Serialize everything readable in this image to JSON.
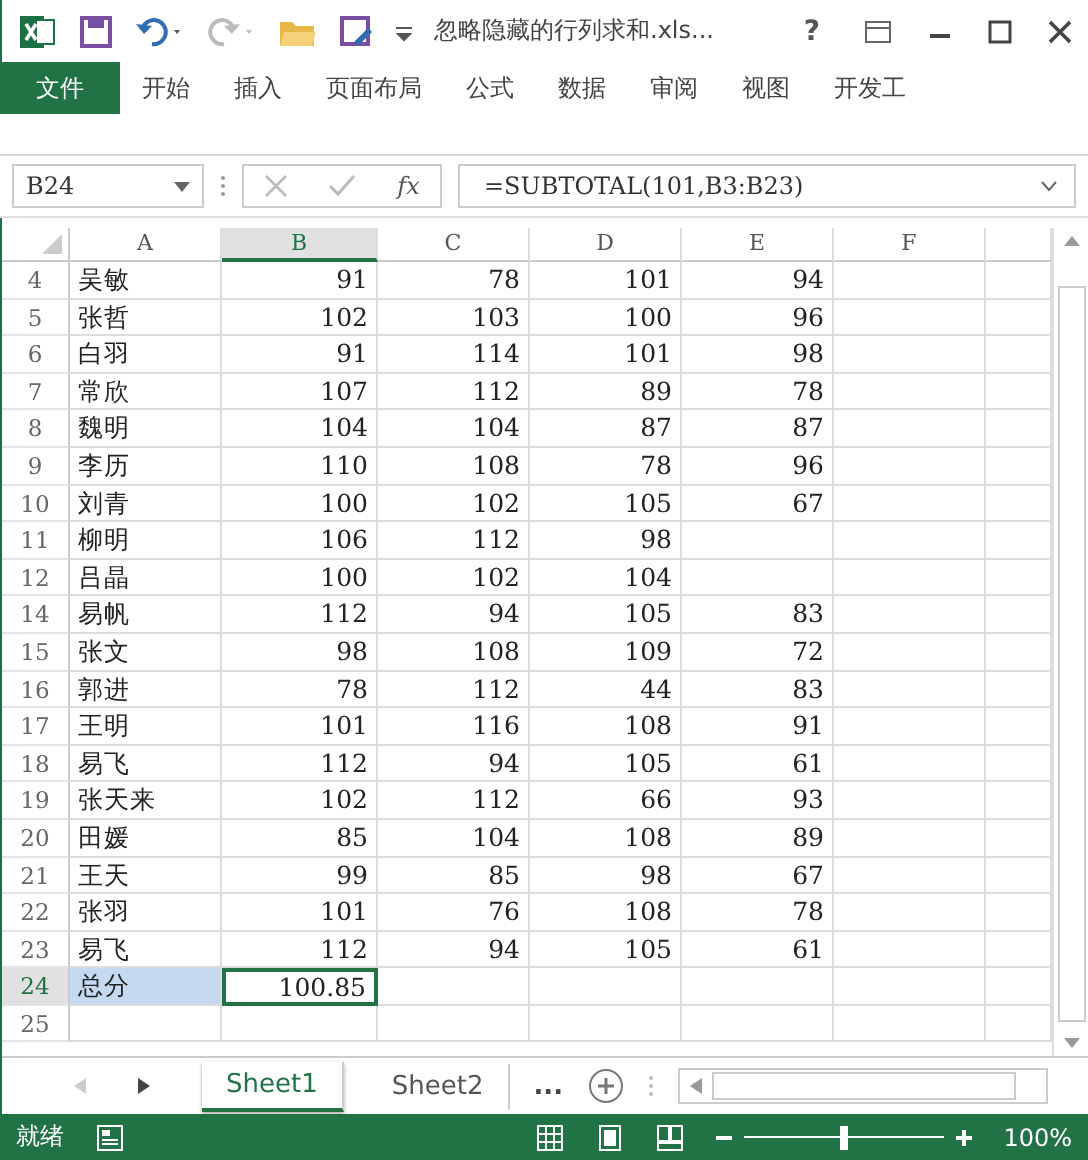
{
  "window": {
    "title": "忽略隐藏的行列求和.xls...",
    "help": "?"
  },
  "ribbon_tabs": [
    {
      "label": "文件",
      "selected": true
    },
    {
      "label": "开始",
      "selected": false
    },
    {
      "label": "插入",
      "selected": false
    },
    {
      "label": "页面布局",
      "selected": false
    },
    {
      "label": "公式",
      "selected": false
    },
    {
      "label": "数据",
      "selected": false
    },
    {
      "label": "审阅",
      "selected": false
    },
    {
      "label": "视图",
      "selected": false
    },
    {
      "label": "开发工",
      "selected": false
    }
  ],
  "formula_bar": {
    "name_box": "B24",
    "fx": "fx",
    "formula": "=SUBTOTAL(101,B3:B23)"
  },
  "columns": [
    {
      "label": "A",
      "selected": false
    },
    {
      "label": "B",
      "selected": true
    },
    {
      "label": "C",
      "selected": false
    },
    {
      "label": "D",
      "selected": false
    },
    {
      "label": "E",
      "selected": false
    },
    {
      "label": "F",
      "selected": false
    }
  ],
  "rows": [
    {
      "n": "4",
      "cells": [
        "吴敏",
        "91",
        "78",
        "101",
        "94"
      ],
      "selected": false
    },
    {
      "n": "5",
      "cells": [
        "张哲",
        "102",
        "103",
        "100",
        "96"
      ],
      "selected": false
    },
    {
      "n": "6",
      "cells": [
        "白羽",
        "91",
        "114",
        "101",
        "98"
      ],
      "selected": false
    },
    {
      "n": "7",
      "cells": [
        "常欣",
        "107",
        "112",
        "89",
        "78"
      ],
      "selected": false
    },
    {
      "n": "8",
      "cells": [
        "魏明",
        "104",
        "104",
        "87",
        "87"
      ],
      "selected": false
    },
    {
      "n": "9",
      "cells": [
        "李历",
        "110",
        "108",
        "78",
        "96"
      ],
      "selected": false
    },
    {
      "n": "10",
      "cells": [
        "刘青",
        "100",
        "102",
        "105",
        "67"
      ],
      "selected": false
    },
    {
      "n": "11",
      "cells": [
        "柳明",
        "106",
        "112",
        "98"
      ],
      "selected": false
    },
    {
      "n": "12",
      "cells": [
        "吕晶",
        "100",
        "102",
        "104"
      ],
      "selected": false
    },
    {
      "n": "14",
      "cells": [
        "易帆",
        "112",
        "94",
        "105",
        "83"
      ],
      "selected": false
    },
    {
      "n": "15",
      "cells": [
        "张文",
        "98",
        "108",
        "109",
        "72"
      ],
      "selected": false
    },
    {
      "n": "16",
      "cells": [
        "郭进",
        "78",
        "112",
        "44",
        "83"
      ],
      "selected": false
    },
    {
      "n": "17",
      "cells": [
        "王明",
        "101",
        "116",
        "108",
        "91"
      ],
      "selected": false
    },
    {
      "n": "18",
      "cells": [
        "易飞",
        "112",
        "94",
        "105",
        "61"
      ],
      "selected": false
    },
    {
      "n": "19",
      "cells": [
        "张天来",
        "102",
        "112",
        "66",
        "93"
      ],
      "selected": false
    },
    {
      "n": "20",
      "cells": [
        "田媛",
        "85",
        "104",
        "108",
        "89"
      ],
      "selected": false
    },
    {
      "n": "21",
      "cells": [
        "王天",
        "99",
        "85",
        "98",
        "67"
      ],
      "selected": false
    },
    {
      "n": "22",
      "cells": [
        "张羽",
        "101",
        "76",
        "108",
        "78"
      ],
      "selected": false
    },
    {
      "n": "23",
      "cells": [
        "易飞",
        "112",
        "94",
        "105",
        "61"
      ],
      "selected": false
    },
    {
      "n": "24",
      "cells": [
        "总分",
        "100.85"
      ],
      "selected": true
    },
    {
      "n": "25",
      "cells": [],
      "selected": false
    }
  ],
  "sheet_tabs": [
    {
      "label": "Sheet1",
      "selected": true
    },
    {
      "label": "Sheet2",
      "selected": false
    }
  ],
  "more_sheets": "...",
  "status_bar": {
    "status": "就绪",
    "zoom": "100%",
    "zoom_slider": {
      "level": 0.5
    }
  }
}
